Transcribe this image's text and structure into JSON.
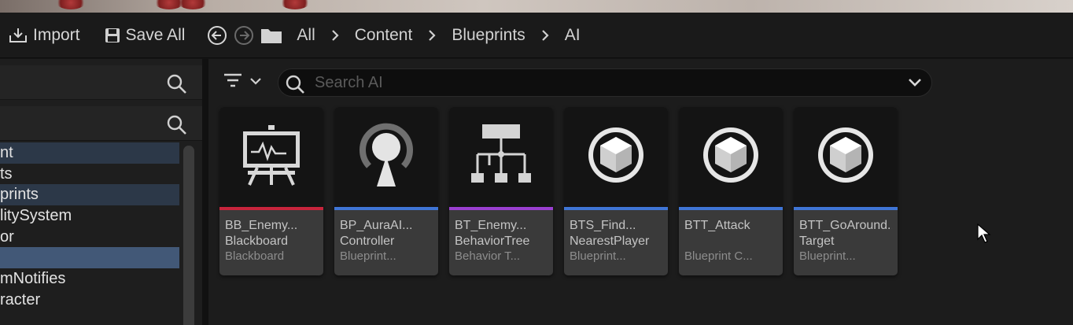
{
  "toolbar": {
    "import_label": "Import",
    "save_all_label": "Save All",
    "breadcrumb": [
      "All",
      "Content",
      "Blueprints",
      "AI"
    ]
  },
  "sidebar": {
    "tree_items": [
      "nt",
      "ts",
      "prints",
      "litySystem",
      "or",
      "",
      "mNotifies",
      "racter"
    ]
  },
  "content": {
    "search_placeholder": "Search AI",
    "assets": [
      {
        "name": "BB_Enemy...",
        "subname": "Blackboard",
        "type": "Blackboard",
        "color": "#c8243c",
        "icon": "blackboard-icon"
      },
      {
        "name": "BP_AuraAI...",
        "subname": "Controller",
        "type": "Blueprint...",
        "color": "#3f75d6",
        "icon": "ai-controller-icon"
      },
      {
        "name": "BT_Enemy...",
        "subname": "BehaviorTree",
        "type": "Behavior T...",
        "color": "#9b3fd1",
        "icon": "behavior-tree-icon"
      },
      {
        "name": "BTS_Find...",
        "subname": "NearestPlayer",
        "type": "Blueprint...",
        "color": "#3f75d6",
        "icon": "cube-icon"
      },
      {
        "name": "BTT_Attack",
        "subname": "",
        "type": "Blueprint C...",
        "color": "#3f75d6",
        "icon": "cube-icon"
      },
      {
        "name": "BTT_GoAround...",
        "subname": "Target",
        "type": "Blueprint...",
        "color": "#3f75d6",
        "icon": "cube-icon"
      }
    ]
  }
}
